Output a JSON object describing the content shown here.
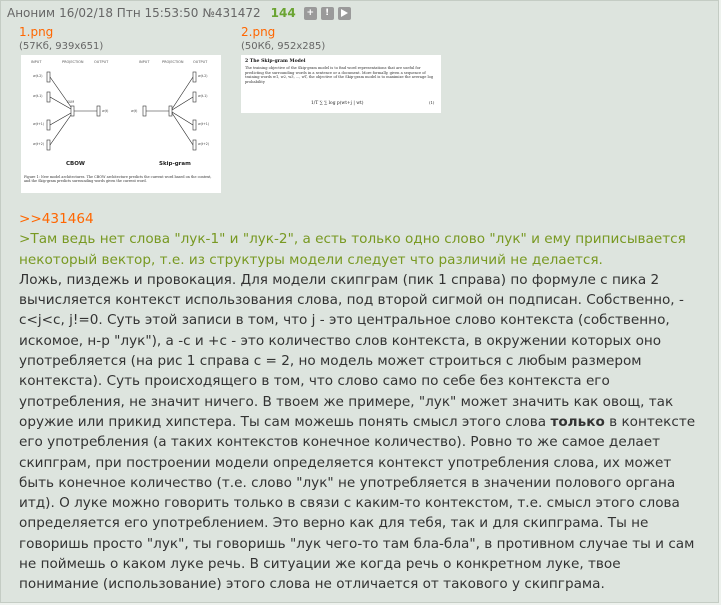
{
  "header": {
    "author": "Аноним",
    "date": "16/02/18 Птн 15:53:50",
    "post_number": "№431472",
    "ordinal": "144",
    "btn_expand": "+",
    "btn_report": "!",
    "btn_play": "▶"
  },
  "files": [
    {
      "name": "1.png",
      "meta": "(57Кб, 939x651)",
      "thumb_labels": {
        "input_left": "INPUT",
        "projection_left": "PROJECTION",
        "output_left": "OUTPUT",
        "input_right": "INPUT",
        "projection_right": "PROJECTION",
        "output_right": "OUTPUT",
        "sum": "SUM",
        "cbow": "CBOW",
        "skipgram": "Skip-gram",
        "w_m2": "w(t-2)",
        "w_m1": "w(t-1)",
        "w_p1": "w(t+1)",
        "w_p2": "w(t+2)",
        "w_t": "w(t)",
        "caption": "Figure 1: New model architectures. The CBOW architecture predicts the current word based on the context, and the Skip-gram predicts surrounding words given the current word."
      }
    },
    {
      "name": "2.png",
      "meta": "(50Кб, 952x285)",
      "thumb_labels": {
        "heading": "2 The Skip-gram Model",
        "paragraph": "The training objective of the Skip-gram model is to find word representations that are useful for predicting the surrounding words in a sentence or a document. More formally, given a sequence of training words w1, w2, w3, ..., wT, the objective of the Skip-gram model is to maximize the average log probability",
        "formula": "1/T ∑ ∑ log p(wt+j | wt)",
        "eqnum": "(1)"
      }
    }
  ],
  "body": {
    "reply_link": ">>431464",
    "quote": ">Там ведь нет слова \"лук-1\" и \"лук-2\", а есть только одно слово \"лук\" и ему приписывается некоторый вектор, т.е. из структуры модели следует что различий не делается.",
    "text_part1": "Ложь, пиздежь и провокация. Для модели скипграм (пик 1 справа) по формуле с пика 2 вычисляется контекст использования слова, под второй сигмой он подписан. Собственно, -c<j<c, j!=0. Суть этой записи в том, что j - это центральное слово контекста (собственно, искомое, н-р \"лук\"), а -с и +с - это количество слов контекста, в окружении которых оно употребляется (на рис 1 справа с = 2, но модель может строиться с любым размером контекста). Суть происходящего в том, что слово само по себе без контекста его употребления, не значит ничего. В твоем же примере, \"лук\" может значить как овощ, так оружие или прикид хипстера. Ты сам можешь понять смысл этого слова ",
    "bold_word": "только",
    "text_part2": " в контексте его употребления (а таких контекстов конечное количество). Ровно то же самое делает скипграм, при построении модели определяется контекст употребления слова, их может быть конечное количество (т.е. слово \"лук\" не употребляется в значении полового органа итд). О луке можно говорить только в связи с каким-то контекстом, т.е. смысл этого слова определяется его употреблением. Это верно как для тебя, так и для скипграма. Ты не говоришь просто \"лук\", ты говоришь \"лук чего-то там бла-бла\", в противном случае ты и сам не поймешь о каком луке речь. В ситуации же когда речь о конкретном луке, твое понимание (использование) этого слова не отличается от такового у скипграма."
  },
  "colors": {
    "post_bg": "#dde4de",
    "page_bg": "#eef2ee",
    "link": "#ff6600",
    "quote": "#789922",
    "ordinal": "#6aa432"
  }
}
